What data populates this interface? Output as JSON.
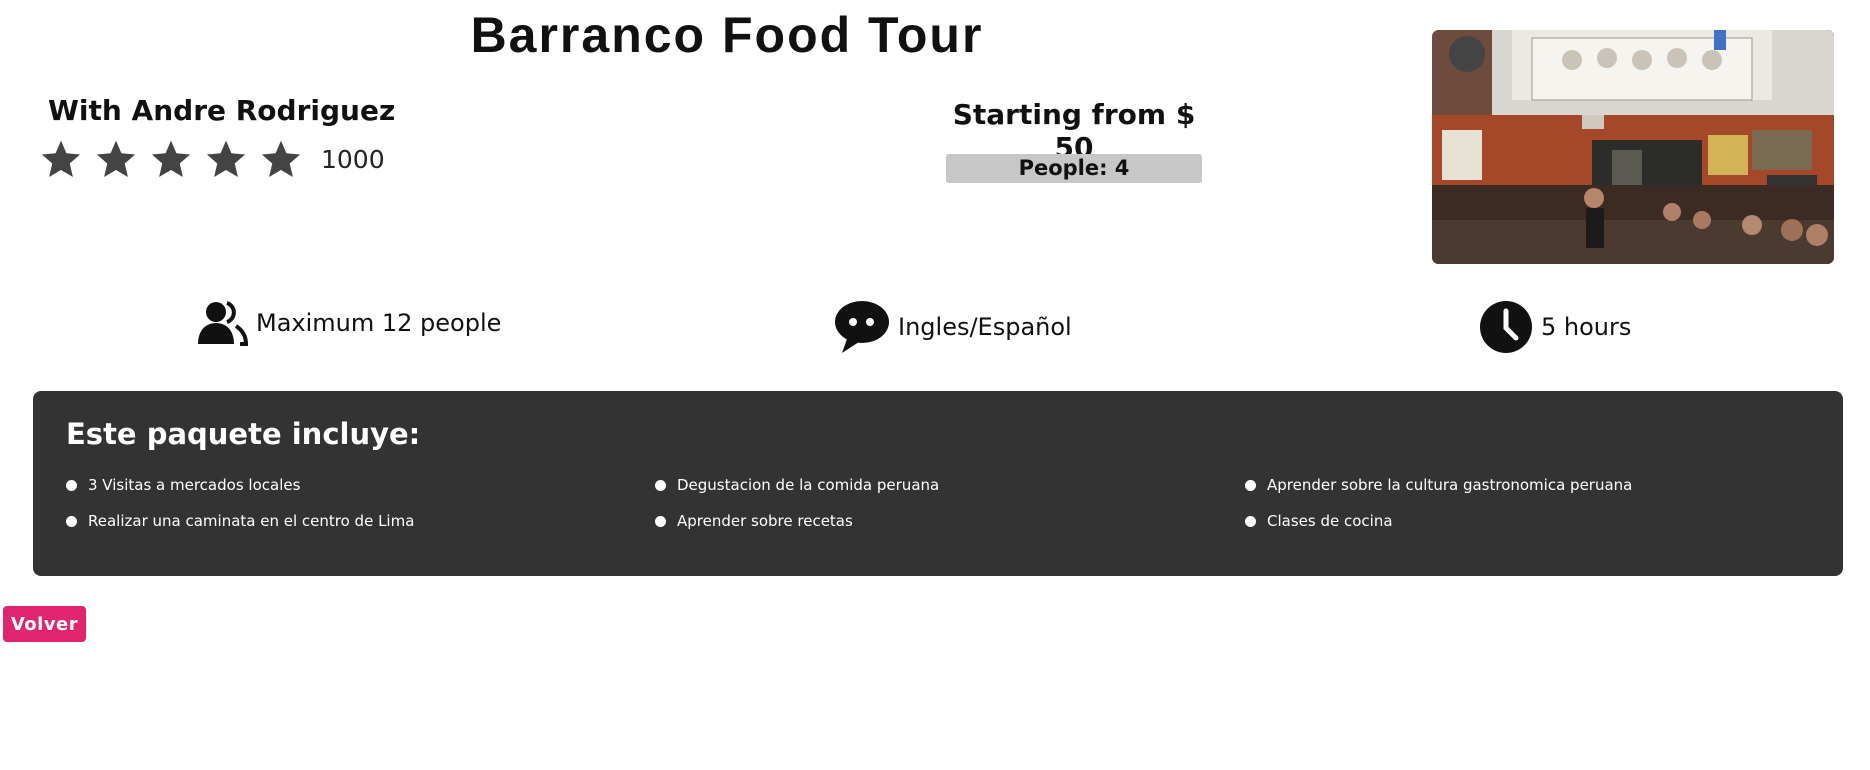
{
  "tour": {
    "title": "Barranco Food Tour",
    "guide_text": "With Andre Rodriguez",
    "rating_stars": 5,
    "rating_count": "1000",
    "price_text": "Starting from $ 50",
    "people_text": "People: 4",
    "photo_alt": ""
  },
  "features": [
    {
      "icon": "people-icon",
      "label": "Maximum 12 people"
    },
    {
      "icon": "speech-bubble-icon",
      "label": "Ingles/Español"
    },
    {
      "icon": "clock-icon",
      "label": "5 hours"
    }
  ],
  "package": {
    "title": "Este paquete incluye:",
    "items": [
      "3 Visitas a mercados locales",
      "Degustacion de la comida peruana",
      "Aprender sobre la cultura gastronomica peruana",
      "Realizar una caminata en el centro de Lima",
      "Aprender sobre recetas",
      "Clases de cocina"
    ]
  },
  "back_button": {
    "label": "Volver"
  },
  "colors": {
    "accent": "#e02470",
    "panel_bg": "#333333",
    "star": "#444444",
    "people_bar": "#c7c7c7"
  }
}
